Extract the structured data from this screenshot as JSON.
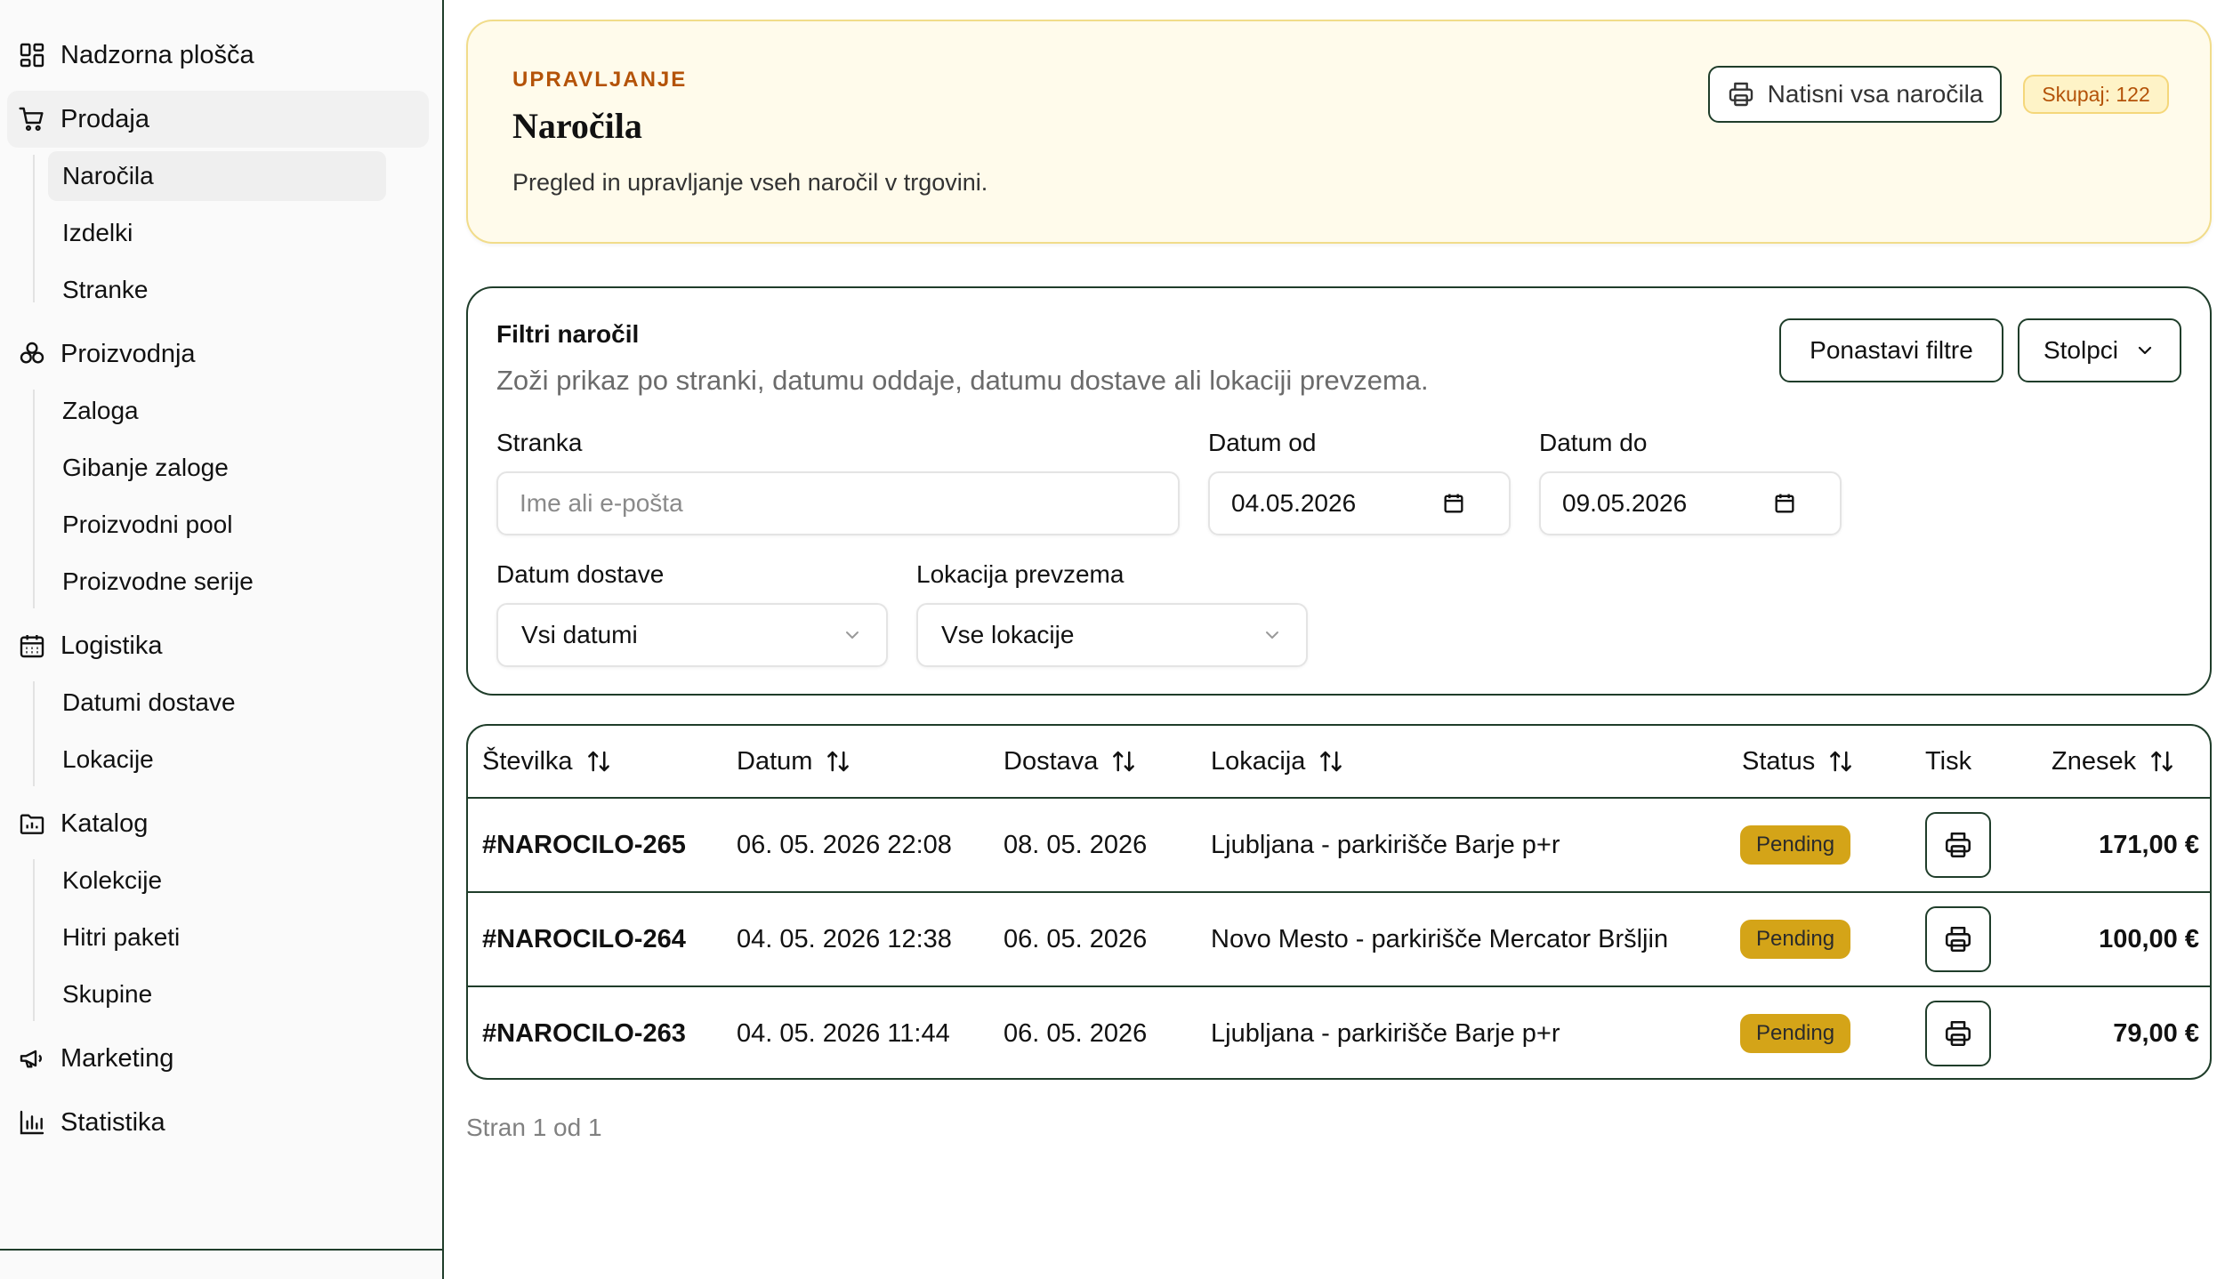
{
  "sidebar": {
    "items": [
      {
        "label": "Nadzorna plošča",
        "icon": "dashboard-icon"
      },
      {
        "label": "Prodaja",
        "icon": "cart-icon",
        "children": [
          "Naročila",
          "Izdelki",
          "Stranke"
        ]
      },
      {
        "label": "Proizvodnja",
        "icon": "production-icon",
        "children": [
          "Zaloga",
          "Gibanje zaloge",
          "Proizvodni pool",
          "Proizvodne serije"
        ]
      },
      {
        "label": "Logistika",
        "icon": "calendar-icon",
        "children": [
          "Datumi dostave",
          "Lokacije"
        ]
      },
      {
        "label": "Katalog",
        "icon": "folder-chart-icon",
        "children": [
          "Kolekcije",
          "Hitri paketi",
          "Skupine"
        ]
      },
      {
        "label": "Marketing",
        "icon": "megaphone-icon"
      },
      {
        "label": "Statistika",
        "icon": "bar-chart-icon"
      }
    ],
    "active_item": "Naročila"
  },
  "header": {
    "eyebrow": "UPRAVLJANJE",
    "title": "Naročila",
    "description": "Pregled in upravljanje vseh naročil v trgovini.",
    "print_all_label": "Natisni vsa naročila",
    "total_badge": "Skupaj: 122"
  },
  "filters": {
    "title": "Filtri naročil",
    "description": "Zoži prikaz po stranki, datumu oddaje, datumu dostave ali lokaciji prevzema.",
    "reset_label": "Ponastavi filtre",
    "columns_label": "Stolpci",
    "customer": {
      "label": "Stranka",
      "placeholder": "Ime ali e-pošta",
      "value": ""
    },
    "date_from": {
      "label": "Datum od",
      "value": "04.05.2026"
    },
    "date_to": {
      "label": "Datum do",
      "value": "09.05.2026"
    },
    "delivery_date": {
      "label": "Datum dostave",
      "value": "Vsi datumi"
    },
    "pickup_location": {
      "label": "Lokacija prevzema",
      "value": "Vse lokacije"
    }
  },
  "table": {
    "columns": [
      "Številka",
      "Datum",
      "Dostava",
      "Lokacija",
      "Status",
      "Tisk",
      "Znesek"
    ],
    "rows": [
      {
        "number": "#NAROCILO-265",
        "date": "06. 05. 2026 22:08",
        "delivery": "08. 05. 2026",
        "location": "Ljubljana - parkirišče Barje p+r",
        "status": "Pending",
        "amount": "171,00 €"
      },
      {
        "number": "#NAROCILO-264",
        "date": "04. 05. 2026 12:38",
        "delivery": "06. 05. 2026",
        "location": "Novo Mesto - parkirišče Mercator Bršljin",
        "status": "Pending",
        "amount": "100,00 €"
      },
      {
        "number": "#NAROCILO-263",
        "date": "04. 05. 2026 11:44",
        "delivery": "06. 05. 2026",
        "location": "Ljubljana - parkirišče Barje p+r",
        "status": "Pending",
        "amount": "79,00 €"
      }
    ]
  },
  "pagination": {
    "text": "Stran 1 od 1"
  },
  "colors": {
    "accent_dark": "#1f3d2a",
    "eyebrow": "#b45309",
    "header_bg": "#fffbeb",
    "status_pending": "#d4a418"
  }
}
